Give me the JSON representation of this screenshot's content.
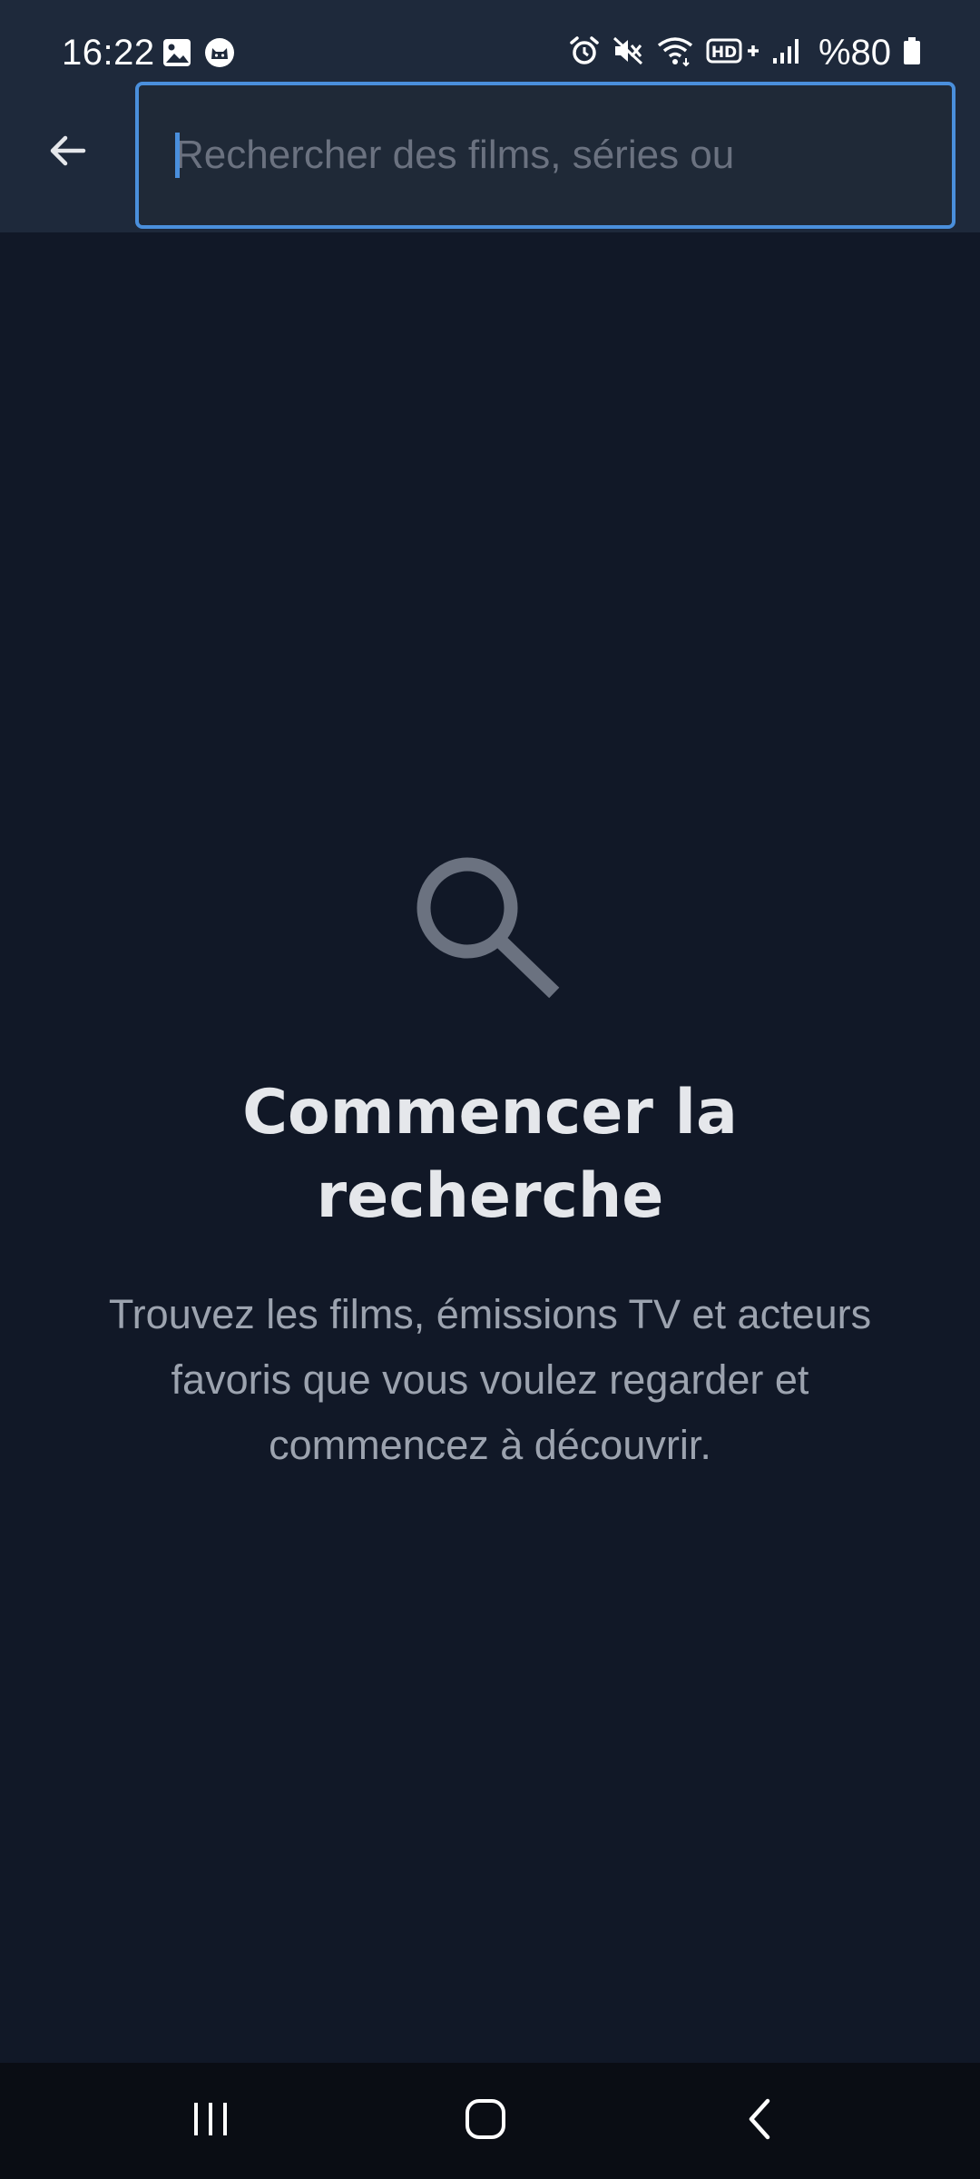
{
  "status_bar": {
    "time": "16:22",
    "battery": "%80",
    "left_icons": [
      "gallery-icon",
      "cat-app-icon"
    ],
    "right_icons": [
      "alarm-icon",
      "mute-icon",
      "wifi-icon",
      "hd-plus-icon",
      "signal-icon",
      "battery-icon"
    ],
    "hd_label": "HD+"
  },
  "header": {
    "back_icon": "arrow-left-icon",
    "search": {
      "value": "",
      "placeholder": "Rechercher des films, séries ou"
    }
  },
  "empty_state": {
    "icon": "search-icon",
    "title": "Commencer la recherche",
    "description": "Trouvez les films, émissions TV et acteurs favoris que vous voulez regarder et commencez à découvrir."
  },
  "nav_bar": {
    "buttons": [
      "recent-apps-icon",
      "home-icon",
      "back-icon"
    ]
  },
  "colors": {
    "background": "#111827",
    "header": "#1e293b",
    "accent": "#4a8fdc",
    "title": "#e5e7eb",
    "muted": "#9ca3af",
    "icon_gray": "#6b7280"
  }
}
